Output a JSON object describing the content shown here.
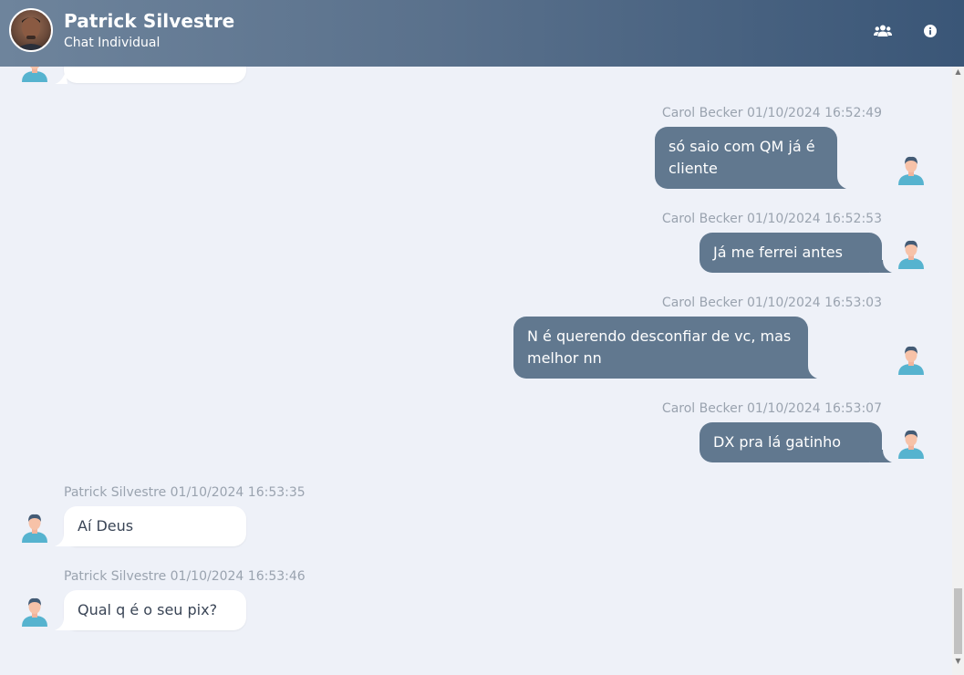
{
  "header": {
    "title": "Patrick Silvestre",
    "subtitle": "Chat Individual",
    "contact_icon": "users-icon",
    "info_icon": "info-icon"
  },
  "messages": [
    {
      "direction": "in",
      "sender": "",
      "timestamp": "",
      "text": ""
    },
    {
      "direction": "out",
      "sender": "Carol Becker",
      "timestamp": "01/10/2024 16:52:49",
      "meta": "Carol Becker 01/10/2024 16:52:49",
      "text": "só saio com QM já é cliente"
    },
    {
      "direction": "out",
      "sender": "Carol Becker",
      "timestamp": "01/10/2024 16:52:53",
      "meta": "Carol Becker 01/10/2024 16:52:53",
      "text": "Já me ferrei antes"
    },
    {
      "direction": "out",
      "sender": "Carol Becker",
      "timestamp": "01/10/2024 16:53:03",
      "meta": "Carol Becker 01/10/2024 16:53:03",
      "text": "N é querendo desconfiar de vc, mas melhor nn"
    },
    {
      "direction": "out",
      "sender": "Carol Becker",
      "timestamp": "01/10/2024 16:53:07",
      "meta": "Carol Becker 01/10/2024 16:53:07",
      "text": "DX pra lá gatinho"
    },
    {
      "direction": "in",
      "sender": "Patrick Silvestre",
      "timestamp": "01/10/2024 16:53:35",
      "meta": "Patrick Silvestre 01/10/2024 16:53:35",
      "text": "Aí Deus"
    },
    {
      "direction": "in",
      "sender": "Patrick Silvestre",
      "timestamp": "01/10/2024 16:53:46",
      "meta": "Patrick Silvestre 01/10/2024 16:53:46",
      "text": "Qual q é o seu pix?"
    }
  ],
  "colors": {
    "header_start": "#6e849c",
    "header_end": "#3a5677",
    "outgoing_bubble": "#61788f",
    "incoming_bubble": "#ffffff",
    "background": "#eef1f8",
    "meta_text": "#9aa3af"
  }
}
